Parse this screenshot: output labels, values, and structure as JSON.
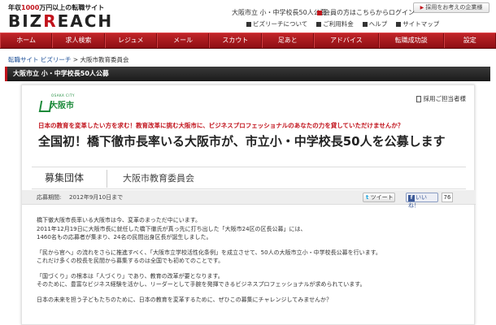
{
  "header": {
    "tagline_prefix": "年収",
    "tagline_amount": "1000",
    "tagline_suffix": "万円以上の転職サイト",
    "logo_part1": "BIZ",
    "logo_part2": "R",
    "logo_part3": "EACH",
    "corporate_link": "採用をお考えの企業様",
    "school_title": "大阪市立 小・中学校長50人公募",
    "login_link": "会員の方はこちらからログイン",
    "links": [
      "ビズリーチについて",
      "ご利用料金",
      "ヘルプ",
      "サイトマップ"
    ]
  },
  "nav": {
    "items": [
      "ホーム",
      "求人検索",
      "レジュメ",
      "メール",
      "スカウト",
      "足あと",
      "アドバイス",
      "転職成功談",
      "設定"
    ]
  },
  "breadcrumb": {
    "site": "転職サイト ビズリーチ",
    "separator": ">",
    "current": "大阪市教育委員会"
  },
  "titlebar": {
    "title": "大阪市立 小・中学校長50人公募"
  },
  "card": {
    "org_logo_small": "OSAKA CITY",
    "org_logo_name": "大阪市",
    "contact_label": "採用ご担当者様",
    "catch_copy": "日本の教育を変革したい方を求む！教育改革に挑む大阪市に、ビジネスプロフェッショナルのあなたの力を貸していただけませんか？",
    "headline": "全国初！橋下徹市長率いる大阪市が、市立小・中学校長50人を公募します",
    "org_label": "募集団体",
    "org_value": "大阪市教育委員会",
    "period_label": "応募期間:",
    "period_value": "2012年9月10日まで",
    "tweet_label": "ツイート",
    "like_label": "いいね！",
    "like_count": "76",
    "body": [
      "橋下徹大阪市長率いる大阪市は今、変革のまっただ中にいます。",
      "2011年12月19日に大阪市長に就任した橋下徹氏が真っ先に打ち出した「大阪市24区の区長公募」には、",
      "1460名もの応募者が集まり、24名の民間出身区長が誕生しました。",
      "「民から官へ」の流れをさらに推進すべく、「大阪市立学校活性化条例」を成立させて、50人の大阪市立小・中学校長公募を行います。",
      "これだけ多くの校長を民間から募集するのは全国でも初めてのことです。",
      "「国づくり」の根本は「人づくり」であり、教育の改革が要となります。",
      "そのために、豊富なビジネス経験を活かし、リーダーとして手腕を発揮できるビジネスプロフェッショナルが求められています。",
      "日本の未来を担う子どもたちのために、日本の教育を変革するために、ぜひこの募集にチャレンジしてみませんか？"
    ]
  },
  "colors": {
    "brand_red": "#c1121b",
    "nav_red": "#a8161c",
    "osaka_green": "#1c8a3a",
    "link_blue": "#1a4d96"
  }
}
